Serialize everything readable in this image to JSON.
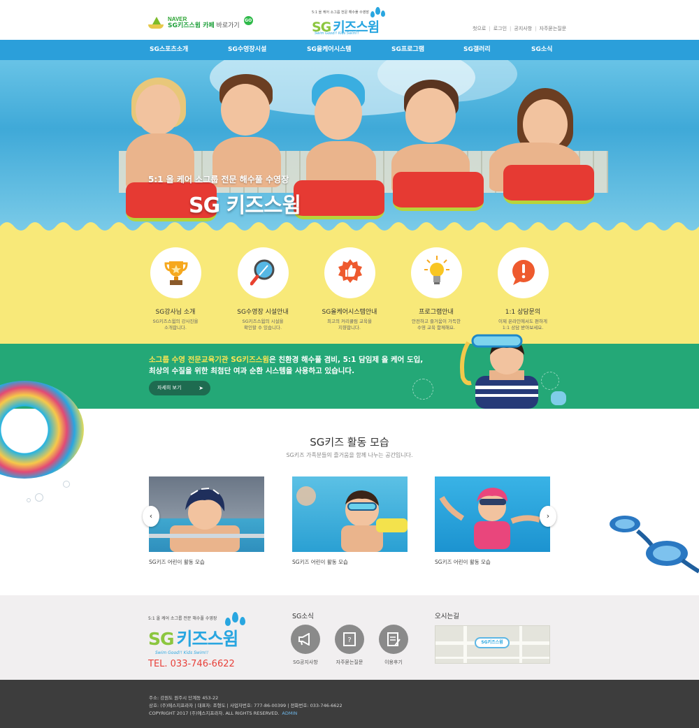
{
  "header": {
    "naver_brand": "NAVER",
    "naver_link_bold": "SG키즈스윔 카페",
    "naver_link_rest": " 바로가기",
    "go_badge": "GO",
    "logo_tagline": "5:1 올 케어 소그룹 전문 해수풀 수영장",
    "logo_sg": "SG",
    "logo_name": "키즈스윔",
    "logo_slogan": "Swim Good!! Kids Swim!!",
    "util_links": [
      "첫으로",
      "로그인",
      "공지사항",
      "자주묻는질문"
    ]
  },
  "nav": {
    "items": [
      "SG스포츠소개",
      "SG수영장시설",
      "SG올케어시스템",
      "SG프로그램",
      "SG갤러리",
      "SG소식"
    ]
  },
  "hero": {
    "line1": "5:1 올 케어 소그룹 전문 해수풀 수영장",
    "title": "SG 키즈스윔"
  },
  "services": [
    {
      "title": "SG강사님 소개",
      "desc1": "SG키즈스윔의 강사진을",
      "desc2": "소개합니다.",
      "icon": "trophy-icon"
    },
    {
      "title": "SG수영장 시설안내",
      "desc1": "SG키즈스윔의 시설을",
      "desc2": "확인할 수 있습니다.",
      "icon": "magnifier-icon"
    },
    {
      "title": "SG올케어시스템안내",
      "desc1": "최고의 커리큘럼 교육을",
      "desc2": "지향합니다.",
      "icon": "thumbs-up-icon"
    },
    {
      "title": "프로그램안내",
      "desc1": "안전하고 즐거움이 가득한",
      "desc2": "수영 교육 함께해요.",
      "icon": "lightbulb-icon"
    },
    {
      "title": "1:1 상담문의",
      "desc1": "이제 온라인에서도 편하게",
      "desc2": "1:1 상담 받아보세요.",
      "icon": "alert-bubble-icon"
    }
  ],
  "promo": {
    "hl": "소그룹 수영 전문교육기관 SG키즈스윔",
    "line1_rest": "은 친환경 해수풀 겸비, 5:1 담임제 올 케어 도입,",
    "line2": "최상의 수질을 위한 최첨단 여과 순환 시스템을 사용하고 있습니다.",
    "button": "자세히 보기",
    "button_arrow": "➤"
  },
  "gallery": {
    "title": "SG키즈 활동 모습",
    "subtitle": "SG키즈 가족분들의 즐거움을 함께 나누는 공간입니다.",
    "items": [
      {
        "caption": "SG키즈 어린이 활동 모습"
      },
      {
        "caption": "SG키즈 어린이 활동 모습"
      },
      {
        "caption": "SG키즈 어린이 활동 모습"
      }
    ],
    "prev": "‹",
    "next": "›"
  },
  "footer_info": {
    "tagline": "5:1 올 케어 소그룹 전문 해수풀 수영장",
    "logo_sg": "SG",
    "logo_name": "키즈스윔",
    "slogan": "Swim Good!! Kids Swim!!",
    "tel": "TEL. 033-746-6622",
    "news_title": "SG소식",
    "news_items": [
      {
        "label": "SG공지사항",
        "icon": "megaphone-icon"
      },
      {
        "label": "자주묻는질문",
        "icon": "faq-icon"
      },
      {
        "label": "이용후기",
        "icon": "review-icon"
      }
    ],
    "map_title": "오시는길",
    "map_marker": "SG키즈스윔"
  },
  "footer": {
    "address": "주소: 강원도 원주시 단계동 453-22",
    "company": "상호: (주)에스지프라자 | 대표자: 조형도 | 사업자번호: 777-86-00399 | 전화번호: 033-746-6622",
    "copyright": "COPYRIGHT 2017 (주)에스지프라자. ALL RIGHTS RESERVED.",
    "admin": "ADMIN"
  },
  "colors": {
    "nav": "#2b9fda",
    "yellow_band": "#f8e979",
    "green_band": "#24a877",
    "footer_dark": "#3d3d3d",
    "tel_red": "#e8413a"
  }
}
